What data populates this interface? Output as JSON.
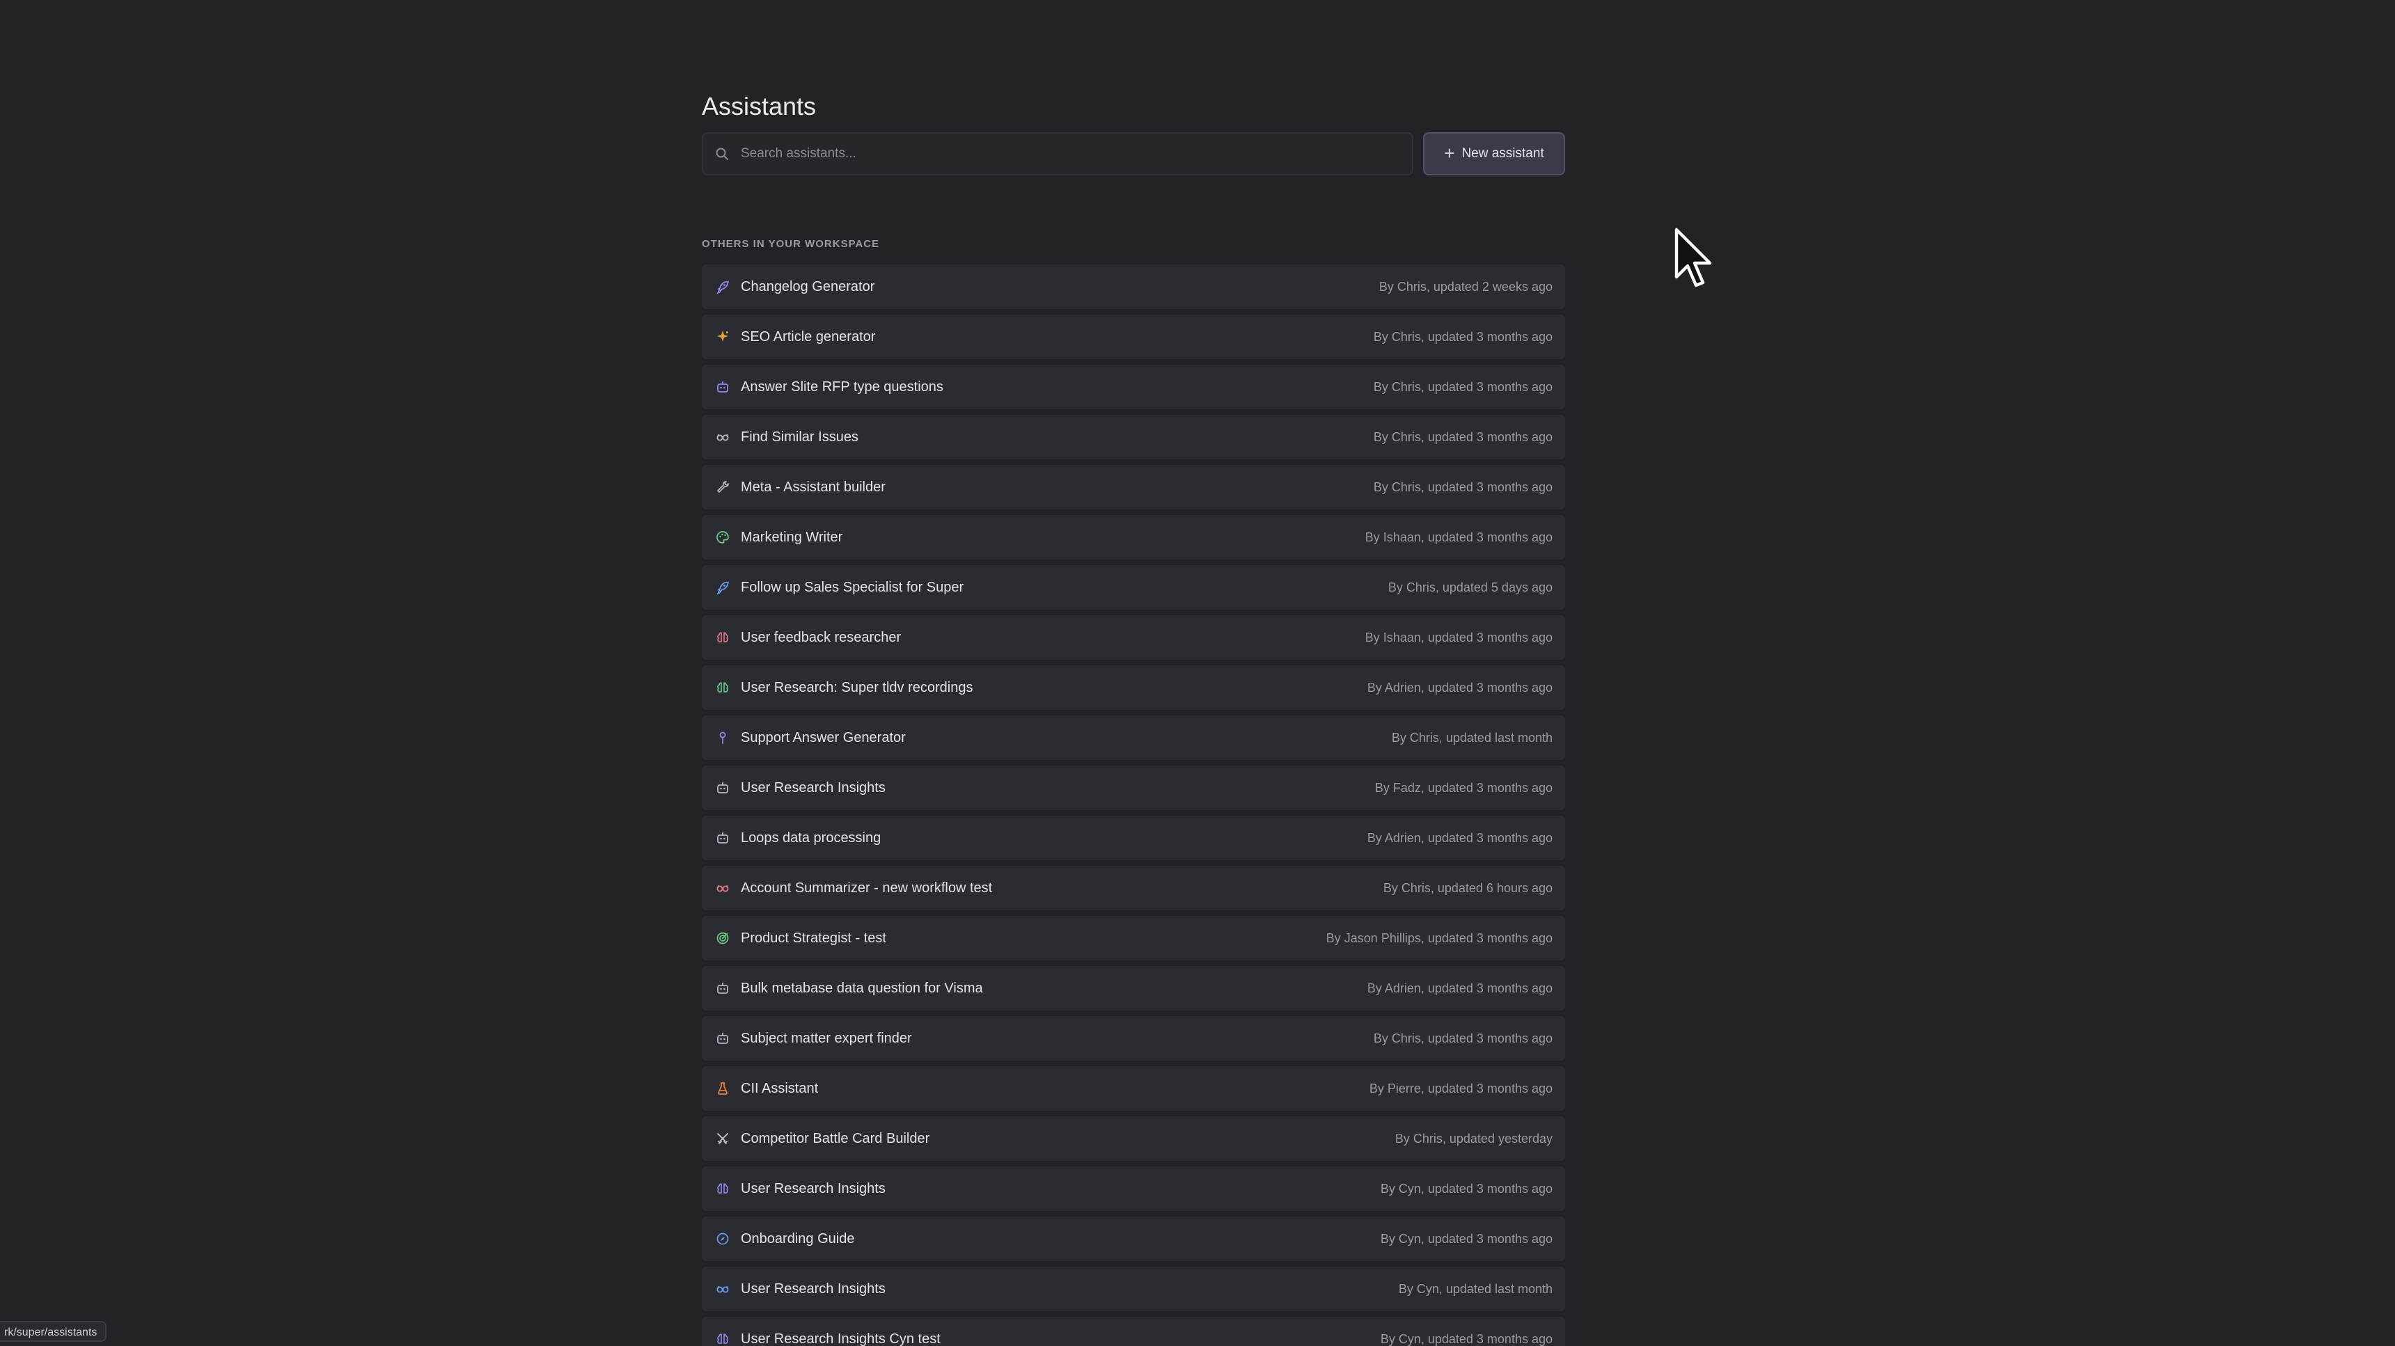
{
  "header": {
    "title": "Assistants",
    "search_placeholder": "Search assistants...",
    "new_button_label": "New assistant"
  },
  "section": {
    "label": "OTHERS IN YOUR WORKSPACE"
  },
  "colors": {
    "background": "#222327",
    "row_background": "#2b2c31",
    "button_background": "#3a3b4a"
  },
  "assistants": [
    {
      "name": "Changelog Generator",
      "meta": "By Chris, updated 2 weeks ago",
      "icon": "rocket-icon",
      "color": "#8f8cf0"
    },
    {
      "name": "SEO Article generator",
      "meta": "By Chris, updated 3 months ago",
      "icon": "sparkle-icon",
      "color": "#e0a23a"
    },
    {
      "name": "Answer Slite RFP type questions",
      "meta": "By Chris, updated 3 months ago",
      "icon": "robot-icon",
      "color": "#8f8cf0"
    },
    {
      "name": "Find Similar Issues",
      "meta": "By Chris, updated 3 months ago",
      "icon": "glasses-icon",
      "color": "#b8b8c4"
    },
    {
      "name": "Meta - Assistant builder",
      "meta": "By Chris, updated 3 months ago",
      "icon": "wrench-icon",
      "color": "#b8b8c4"
    },
    {
      "name": "Marketing Writer",
      "meta": "By Ishaan, updated 3 months ago",
      "icon": "palette-icon",
      "color": "#6fcf8a"
    },
    {
      "name": "Follow up Sales Specialist for Super",
      "meta": "By Chris, updated 5 days ago",
      "icon": "rocket-icon",
      "color": "#6a9cf0"
    },
    {
      "name": "User feedback researcher",
      "meta": "By Ishaan, updated 3 months ago",
      "icon": "brain-icon",
      "color": "#e87a8c"
    },
    {
      "name": "User Research: Super tldv recordings",
      "meta": "By Adrien, updated 3 months ago",
      "icon": "brain-icon",
      "color": "#6fcf8a"
    },
    {
      "name": "Support Answer Generator",
      "meta": "By Chris, updated last month",
      "icon": "pin-icon",
      "color": "#8f8cf0"
    },
    {
      "name": "User Research Insights",
      "meta": "By Fadz, updated 3 months ago",
      "icon": "robot-icon",
      "color": "#b8b8c4"
    },
    {
      "name": "Loops data processing",
      "meta": "By Adrien, updated 3 months ago",
      "icon": "robot-icon",
      "color": "#b8b8c4"
    },
    {
      "name": "Account Summarizer - new workflow test",
      "meta": "By Chris, updated 6 hours ago",
      "icon": "glasses-icon",
      "color": "#e87a8c"
    },
    {
      "name": "Product Strategist - test",
      "meta": "By Jason Phillips, updated 3 months ago",
      "icon": "target-icon",
      "color": "#6fcf8a"
    },
    {
      "name": "Bulk metabase data question for Visma",
      "meta": "By Adrien, updated 3 months ago",
      "icon": "robot-icon",
      "color": "#b8b8c4"
    },
    {
      "name": "Subject matter expert finder",
      "meta": "By Chris, updated 3 months ago",
      "icon": "robot-icon",
      "color": "#b8b8c4"
    },
    {
      "name": "CII Assistant",
      "meta": "By Pierre, updated 3 months ago",
      "icon": "flask-icon",
      "color": "#e8843a"
    },
    {
      "name": "Competitor Battle Card Builder",
      "meta": "By Chris, updated yesterday",
      "icon": "swords-icon",
      "color": "#c8c8d2"
    },
    {
      "name": "User Research Insights",
      "meta": "By Cyn, updated 3 months ago",
      "icon": "brain-icon",
      "color": "#8f8cf0"
    },
    {
      "name": "Onboarding Guide",
      "meta": "By Cyn, updated 3 months ago",
      "icon": "compass-icon",
      "color": "#6a9cf0"
    },
    {
      "name": "User Research Insights",
      "meta": "By Cyn, updated last month",
      "icon": "glasses-icon",
      "color": "#6a9cf0"
    },
    {
      "name": "User Research Insights Cyn test",
      "meta": "By Cyn, updated 3 months ago",
      "icon": "brain-icon",
      "color": "#8f8cf0"
    }
  ],
  "status_bar": {
    "url": "rk/super/assistants"
  }
}
